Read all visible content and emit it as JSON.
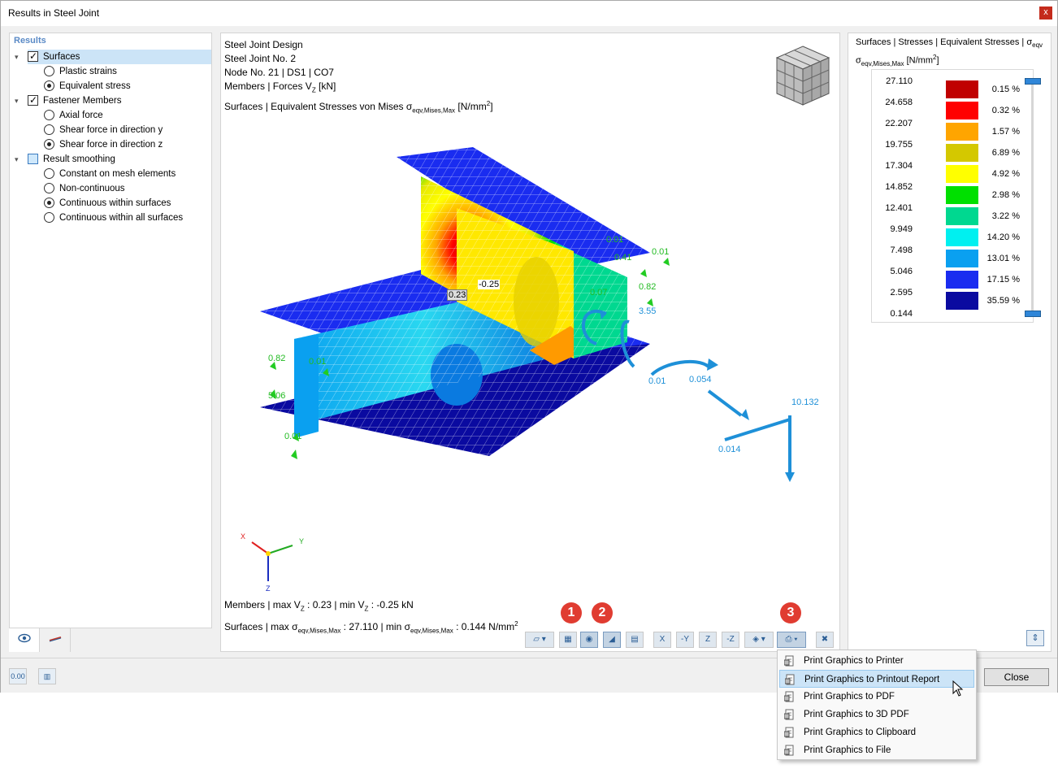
{
  "window": {
    "title": "Results in Steel Joint",
    "close_glyph": "x"
  },
  "tree": {
    "heading": "Results",
    "items": [
      {
        "label": "Surfaces",
        "type": "checkbox",
        "state": "checked",
        "caret": "▾",
        "selected": true
      },
      {
        "label": "Plastic strains",
        "type": "radio",
        "state": "off"
      },
      {
        "label": "Equivalent stress",
        "type": "radio",
        "state": "on"
      },
      {
        "label": "Fastener Members",
        "type": "checkbox",
        "state": "checked",
        "caret": "▾"
      },
      {
        "label": "Axial force",
        "type": "radio",
        "state": "off"
      },
      {
        "label": "Shear force in direction y",
        "type": "radio",
        "state": "off"
      },
      {
        "label": "Shear force in direction z",
        "type": "radio",
        "state": "on"
      },
      {
        "label": "Result smoothing",
        "type": "checkbox",
        "state": "partial",
        "caret": "▾"
      },
      {
        "label": "Constant on mesh elements",
        "type": "radio",
        "state": "off"
      },
      {
        "label": "Non-continuous",
        "type": "radio",
        "state": "off"
      },
      {
        "label": "Continuous within surfaces",
        "type": "radio",
        "state": "on"
      },
      {
        "label": "Continuous within all surfaces",
        "type": "radio",
        "state": "off"
      }
    ]
  },
  "graphic": {
    "info": {
      "line1": "Steel Joint Design",
      "line2": "Steel Joint No. 2",
      "line3": "Node No. 21 | DS1 | CO7",
      "line4_pre": "Members | Forces V",
      "line4_sub": "Z",
      "line4_post": " [kN]",
      "line5_pre": "Surfaces | Equivalent Stresses von Mises σ",
      "line5_sub": "eqv,Mises,Max",
      "line5_post": " [N/mm",
      "line5_sup": "2",
      "line5_end": "]"
    },
    "footer": {
      "m_a": "Members | max V",
      "m_sub1": "Z",
      "m_b": " : 0.23 | min V",
      "m_sub2": "Z",
      "m_c": " : -0.25 kN",
      "s_a": "Surfaces | max σ",
      "s_sub1": "eqv,Mises,Max",
      "s_b": " : 27.110 | min σ",
      "s_sub2": "eqv,Mises,Max",
      "s_c": " : 0.144 N/mm",
      "s_sup": "2"
    },
    "labels": {
      "l1": "-0.25",
      "l2": "0.23",
      "l3": "0.01",
      "l4": "0.01",
      "l5": "0.41",
      "l6": "0.82",
      "l7": "0.07",
      "l8": "3.55",
      "l9": "0.82",
      "l10": "0.01",
      "l11": "5.06",
      "l12": "0.01",
      "l13": "0.01",
      "l14": "0.054",
      "l15": "10.132",
      "l16": "0.014"
    },
    "axes": {
      "x": "X",
      "y": "Y",
      "z": "Z"
    },
    "callouts": [
      "1",
      "2",
      "3"
    ],
    "toolbar_icons": [
      "surface-display-icon",
      "mesh-view-icon",
      "view-display-icon",
      "result-values-icon",
      "color-scale-icon",
      "view-x-icon",
      "view-minus-y-icon",
      "view-z-icon",
      "view-minus-z-icon",
      "iso-view-icon",
      "print-icon",
      "deactivate-results-icon"
    ],
    "toolbar_text": {
      "x": "X",
      "my": "-Y",
      "z": "Z",
      "mz": "-Z"
    }
  },
  "legend": {
    "title_a": "Surfaces | Stresses | Equivalent Stresses | σ",
    "title_sub": "eqv",
    "title_b": "σ",
    "title_sub2": "eqv,Mises,Max",
    "title_c": " [N/mm",
    "title_sup": "2",
    "title_d": "]",
    "values": [
      "27.110",
      "24.658",
      "22.207",
      "19.755",
      "17.304",
      "14.852",
      "12.401",
      "9.949",
      "7.498",
      "5.046",
      "2.595",
      "0.144"
    ],
    "colors": [
      "#c00000",
      "#ff0000",
      "#ffa500",
      "#d4c800",
      "#ffff00",
      "#00e000",
      "#00d890",
      "#00f0f0",
      "#0aa0f0",
      "#1a2cf0",
      "#0a0aa0"
    ],
    "percents": [
      "0.15 %",
      "0.32 %",
      "1.57 %",
      "6.89 %",
      "4.92 %",
      "2.98 %",
      "3.22 %",
      "14.20 %",
      "13.01 %",
      "17.15 %",
      "35.59 %"
    ]
  },
  "bottom": {
    "close_label": "Close",
    "b1_label": "0.00"
  },
  "print_menu": {
    "items": [
      "Print Graphics to Printer",
      "Print Graphics to Printout Report",
      "Print Graphics to PDF",
      "Print Graphics to 3D PDF",
      "Print Graphics to Clipboard",
      "Print Graphics to File"
    ],
    "highlighted_index": 1
  }
}
